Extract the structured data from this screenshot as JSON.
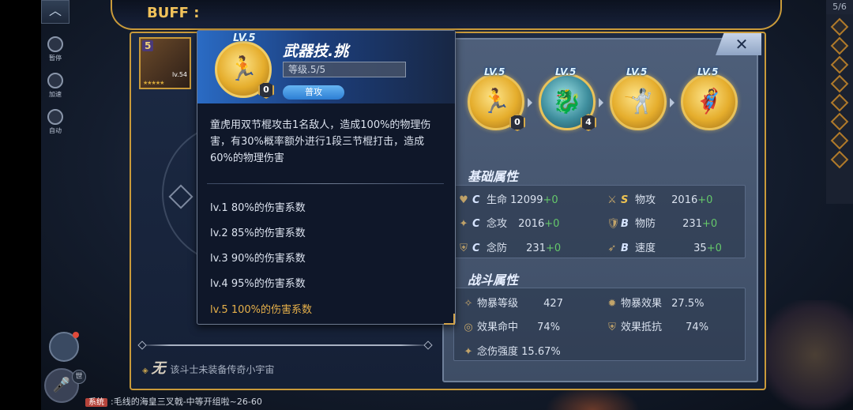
{
  "header": {
    "buff_label": "BUFF :",
    "page_counter": "5/6"
  },
  "hero": {
    "rank": "5",
    "level": "lv.54",
    "stars": "★★★★★"
  },
  "left_hud": {
    "btn1": "暂停",
    "btn2": "加速",
    "btn3": "自动"
  },
  "no_equipment": {
    "mark": "◈",
    "wu": "无",
    "text": "该斗士未装备传奇小宇宙"
  },
  "chat": {
    "channel": "系统",
    "message": ":毛线的海皇三叉戟-中等开组啦~26-60"
  },
  "world_tag": "世",
  "attr_panel": {
    "close_label": "✕",
    "skills": [
      {
        "lv": "LV.5",
        "count": "0",
        "style": "gold",
        "glyph": "🏃"
      },
      {
        "lv": "LV.5",
        "count": "4",
        "style": "teal",
        "glyph": "🐉"
      },
      {
        "lv": "LV.5",
        "count": "",
        "style": "gold",
        "glyph": "🤺"
      },
      {
        "lv": "LV.5",
        "count": "",
        "style": "gold",
        "glyph": "🦸"
      }
    ],
    "basic_title": "基础属性",
    "basic_stats": [
      {
        "icon": "♥",
        "grade": "C",
        "label": "生命",
        "value": "12099",
        "plus": "+0"
      },
      {
        "icon": "⚔",
        "grade": "S",
        "label": "物攻",
        "value": "2016",
        "plus": "+0"
      },
      {
        "icon": "✦",
        "grade": "C",
        "label": "念攻",
        "value": "2016",
        "plus": "+0"
      },
      {
        "icon": "🛡",
        "grade": "B",
        "label": "物防",
        "value": "231",
        "plus": "+0"
      },
      {
        "icon": "⛨",
        "grade": "C",
        "label": "念防",
        "value": "231",
        "plus": "+0"
      },
      {
        "icon": "➶",
        "grade": "B",
        "label": "速度",
        "value": "35",
        "plus": "+0"
      }
    ],
    "battle_title": "战斗属性",
    "battle_stats": [
      {
        "icon": "✧",
        "label": "物暴等级",
        "value": "427"
      },
      {
        "icon": "✹",
        "label": "物暴效果",
        "value": "27.5%"
      },
      {
        "icon": "◎",
        "label": "效果命中",
        "value": "74%"
      },
      {
        "icon": "⛨",
        "label": "效果抵抗",
        "value": "74%"
      },
      {
        "icon": "✦",
        "label": "念伤强度",
        "value": "15.67%"
      }
    ]
  },
  "tooltip": {
    "lv": "LV.5",
    "count": "0",
    "name": "武器技.挑",
    "level_text": "等级.5/5",
    "tag": "普攻",
    "description": "童虎用双节棍攻击1名敌人，造成100%的物理伤害，有30%概率额外进行1段三节棍打击，造成60%的物理伤害",
    "levels": [
      "lv.1 80%的伤害系数",
      "lv.2 85%的伤害系数",
      "lv.3 90%的伤害系数",
      "lv.4 95%的伤害系数",
      "lv.5 100%的伤害系数"
    ]
  }
}
